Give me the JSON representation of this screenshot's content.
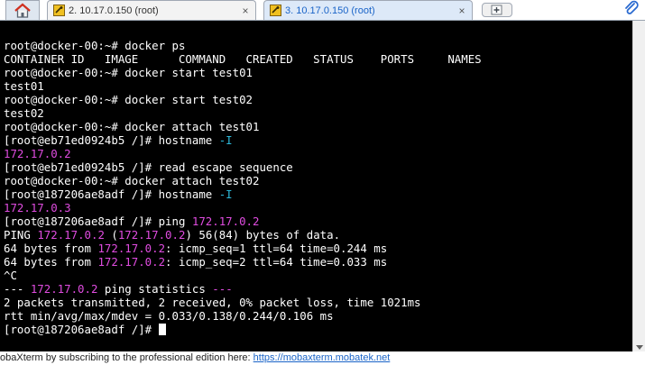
{
  "tabs": [
    {
      "label": "2. 10.17.0.150 (root)",
      "close": "×",
      "active": false
    },
    {
      "label": "3. 10.17.0.150 (root)",
      "close": "×",
      "active": true
    }
  ],
  "terminal": {
    "lines": [
      [
        "root@docker-00:~# docker ps"
      ],
      [
        "CONTAINER ID   IMAGE      COMMAND   CREATED   STATUS    PORTS     NAMES"
      ],
      [
        "root@docker-00:~# docker start test01"
      ],
      [
        "test01"
      ],
      [
        "root@docker-00:~# docker start test02"
      ],
      [
        "test02"
      ],
      [
        "root@docker-00:~# docker attach test01"
      ],
      [
        "[root@eb71ed0924b5 /]# hostname ",
        "-I"
      ],
      [
        "172.17.0.2"
      ],
      [
        "[root@eb71ed0924b5 /]# read escape sequence"
      ],
      [
        "root@docker-00:~# docker attach test02"
      ],
      [
        "[root@187206ae8adf /]# hostname ",
        "-I"
      ],
      [
        "172.17.0.3"
      ],
      [
        "[root@187206ae8adf /]# ping ",
        "172.17.0.2"
      ],
      [
        "PING ",
        "172.17.0.2",
        " (",
        "172.17.0.2",
        ") 56(84) bytes of data."
      ],
      [
        "64 bytes from ",
        "172.17.0.2",
        ": icmp_seq=1 ttl=64 time=0.244 ms"
      ],
      [
        "64 bytes from ",
        "172.17.0.2",
        ": icmp_seq=2 ttl=64 time=0.033 ms"
      ],
      [
        "^C"
      ],
      [
        "--- ",
        "172.17.0.2",
        " ping statistics ",
        "---"
      ],
      [
        "2 packets transmitted, 2 received, 0% packet loss, time 1021ms"
      ],
      [
        "rtt min/avg/max/mdev = 0.033/0.138/0.244/0.106 ms"
      ],
      [
        "[root@187206ae8adf /]# "
      ]
    ],
    "line_colors": [
      [
        "w"
      ],
      [
        "w"
      ],
      [
        "w"
      ],
      [
        "w"
      ],
      [
        "w"
      ],
      [
        "w"
      ],
      [
        "w"
      ],
      [
        "w",
        "c"
      ],
      [
        "m"
      ],
      [
        "w"
      ],
      [
        "w"
      ],
      [
        "w",
        "c"
      ],
      [
        "m"
      ],
      [
        "w",
        "m"
      ],
      [
        "w",
        "m",
        "w",
        "m",
        "w"
      ],
      [
        "w",
        "m",
        "w"
      ],
      [
        "w",
        "m",
        "w"
      ],
      [
        "w"
      ],
      [
        "w",
        "m",
        "w",
        "m"
      ],
      [
        "w"
      ],
      [
        "w"
      ],
      [
        "w"
      ]
    ],
    "colors": {
      "background": "#000000",
      "text": "#ffffff",
      "magenta": "#e04ce0",
      "cyan": "#2db8d8"
    }
  },
  "statusbar": {
    "text": "obaXterm by subscribing to the professional edition here:  ",
    "link": "https://mobaxterm.mobatek.net"
  },
  "icons": {
    "home": "home-icon",
    "tab": "terminal-session-icon",
    "new_tab": "new-tab-icon",
    "attach": "paperclip-icon"
  }
}
